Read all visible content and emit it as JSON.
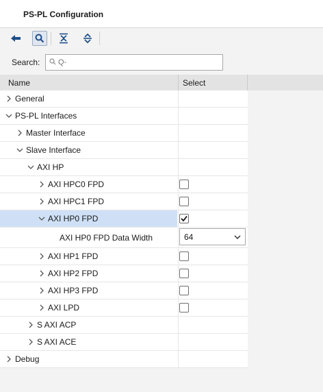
{
  "header": {
    "title": "PS-PL Configuration"
  },
  "toolbar": {
    "back_icon": "back-arrow-icon",
    "search_icon": "search-icon",
    "collapse_icon": "collapse-all-icon",
    "expand_icon": "expand-all-icon"
  },
  "search": {
    "label": "Search:",
    "value": "",
    "placeholder": "Q-"
  },
  "table": {
    "columns": [
      "Name",
      "Select"
    ],
    "rows": [
      {
        "label": "General",
        "chevron": "right",
        "checkbox": null
      },
      {
        "label": "PS-PL Interfaces",
        "chevron": "down",
        "checkbox": null
      },
      {
        "label": "Master Interface",
        "chevron": "right",
        "checkbox": null
      },
      {
        "label": "Slave Interface",
        "chevron": "down",
        "checkbox": null
      },
      {
        "label": "AXI HP",
        "chevron": "down",
        "checkbox": null
      },
      {
        "label": "AXI HPC0 FPD",
        "chevron": "right",
        "checkbox": false
      },
      {
        "label": "AXI HPC1 FPD",
        "chevron": "right",
        "checkbox": false
      },
      {
        "label": "AXI HP0 FPD",
        "chevron": "down",
        "checkbox": true,
        "selected": true
      },
      {
        "label": "AXI HP0 FPD Data Width",
        "chevron": null,
        "dropdown": "64"
      },
      {
        "label": "AXI HP1 FPD",
        "chevron": "right",
        "checkbox": false
      },
      {
        "label": "AXI HP2 FPD",
        "chevron": "right",
        "checkbox": false
      },
      {
        "label": "AXI HP3 FPD",
        "chevron": "right",
        "checkbox": false
      },
      {
        "label": "AXI LPD",
        "chevron": "right",
        "checkbox": false
      },
      {
        "label": "S AXI ACP",
        "chevron": "right",
        "checkbox": null
      },
      {
        "label": "S AXI ACE",
        "chevron": "right",
        "checkbox": null
      },
      {
        "label": "Debug",
        "chevron": "right",
        "checkbox": null
      }
    ]
  },
  "colors": {
    "selected_row": "#cfe0f6",
    "accent": "#1f4f8a"
  }
}
